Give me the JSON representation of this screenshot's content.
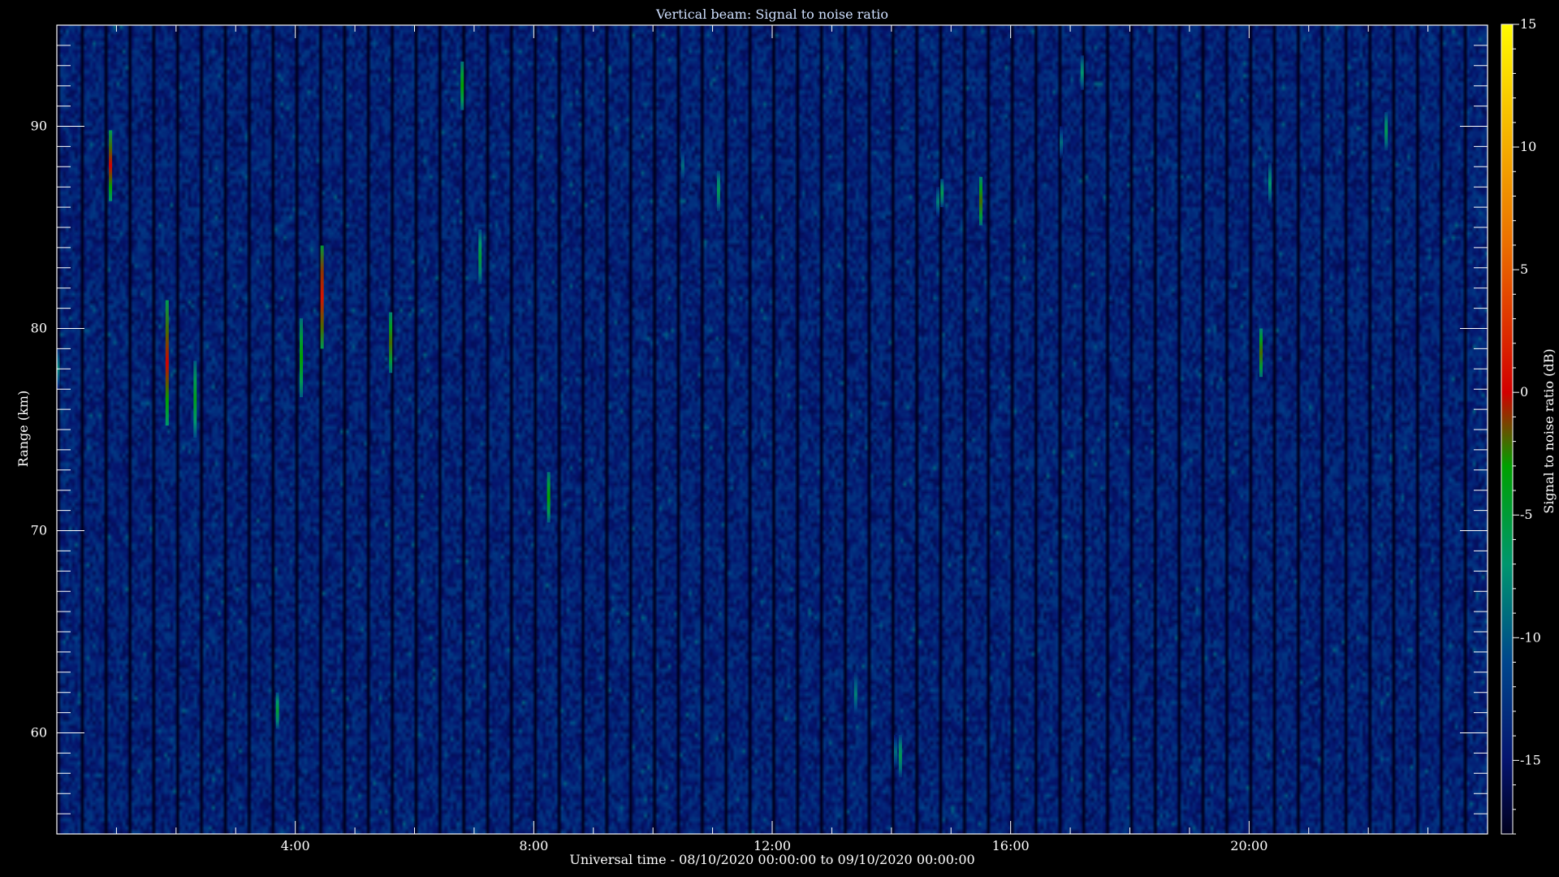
{
  "chart_data": {
    "type": "heatmap",
    "title": "Vertical beam: Signal to noise ratio",
    "xlabel": "Universal time - 08/10/2020 00:00:00 to 09/10/2020 00:00:00",
    "ylabel": "Range (km)",
    "colorbar_label": "Signal to noise ratio (dB)",
    "xlim": [
      0,
      24
    ],
    "ylim": [
      55,
      95
    ],
    "clim": [
      -18,
      15
    ],
    "x_ticks": [
      {
        "value": 4,
        "label": "4:00"
      },
      {
        "value": 8,
        "label": "8:00"
      },
      {
        "value": 12,
        "label": "12:00"
      },
      {
        "value": 16,
        "label": "16:00"
      },
      {
        "value": 20,
        "label": "20:00"
      }
    ],
    "y_ticks": [
      {
        "value": 60,
        "label": "60"
      },
      {
        "value": 70,
        "label": "70"
      },
      {
        "value": 80,
        "label": "80"
      },
      {
        "value": 90,
        "label": "90"
      }
    ],
    "colorbar_ticks": [
      {
        "value": -15,
        "label": "-15"
      },
      {
        "value": -10,
        "label": "-10"
      },
      {
        "value": -5,
        "label": "-5"
      },
      {
        "value": 0,
        "label": "0"
      },
      {
        "value": 5,
        "label": "5"
      },
      {
        "value": 10,
        "label": "10"
      },
      {
        "value": 15,
        "label": "15"
      }
    ],
    "background_snr": -14,
    "echoes": [
      {
        "t": 0.02,
        "r_start": 77.0,
        "r_end": 79.0,
        "snr": -8
      },
      {
        "t": 0.9,
        "r_start": 86.3,
        "r_end": 89.8,
        "snr": 0
      },
      {
        "t": 1.85,
        "r_start": 75.2,
        "r_end": 81.4,
        "snr": 0
      },
      {
        "t": 2.32,
        "r_start": 74.6,
        "r_end": 78.4,
        "snr": -4
      },
      {
        "t": 3.7,
        "r_start": 60.2,
        "r_end": 62.0,
        "snr": -5
      },
      {
        "t": 4.1,
        "r_start": 76.6,
        "r_end": 80.5,
        "snr": -3
      },
      {
        "t": 4.45,
        "r_start": 79.0,
        "r_end": 84.1,
        "snr": 1
      },
      {
        "t": 5.6,
        "r_start": 77.8,
        "r_end": 80.8,
        "snr": -2
      },
      {
        "t": 6.8,
        "r_start": 90.8,
        "r_end": 93.2,
        "snr": -3
      },
      {
        "t": 7.1,
        "r_start": 82.2,
        "r_end": 84.9,
        "snr": -5
      },
      {
        "t": 8.25,
        "r_start": 70.4,
        "r_end": 72.9,
        "snr": -3
      },
      {
        "t": 10.5,
        "r_start": 87.2,
        "r_end": 88.9,
        "snr": -9
      },
      {
        "t": 11.1,
        "r_start": 85.8,
        "r_end": 87.8,
        "snr": -6
      },
      {
        "t": 13.4,
        "r_start": 60.8,
        "r_end": 63.0,
        "snr": -8
      },
      {
        "t": 14.07,
        "r_start": 58.2,
        "r_end": 59.9,
        "snr": -9
      },
      {
        "t": 14.15,
        "r_start": 57.8,
        "r_end": 59.9,
        "snr": -6
      },
      {
        "t": 14.78,
        "r_start": 85.5,
        "r_end": 87.0,
        "snr": -8
      },
      {
        "t": 14.85,
        "r_start": 86.0,
        "r_end": 87.4,
        "snr": -6
      },
      {
        "t": 15.5,
        "r_start": 85.1,
        "r_end": 87.5,
        "snr": -2
      },
      {
        "t": 16.85,
        "r_start": 88.4,
        "r_end": 90.0,
        "snr": -9
      },
      {
        "t": 17.2,
        "r_start": 91.8,
        "r_end": 93.5,
        "snr": -7
      },
      {
        "t": 20.2,
        "r_start": 77.6,
        "r_end": 80.0,
        "snr": -2
      },
      {
        "t": 20.35,
        "r_start": 86.1,
        "r_end": 88.2,
        "snr": -7
      },
      {
        "t": 22.3,
        "r_start": 88.8,
        "r_end": 90.7,
        "snr": -6
      }
    ]
  }
}
